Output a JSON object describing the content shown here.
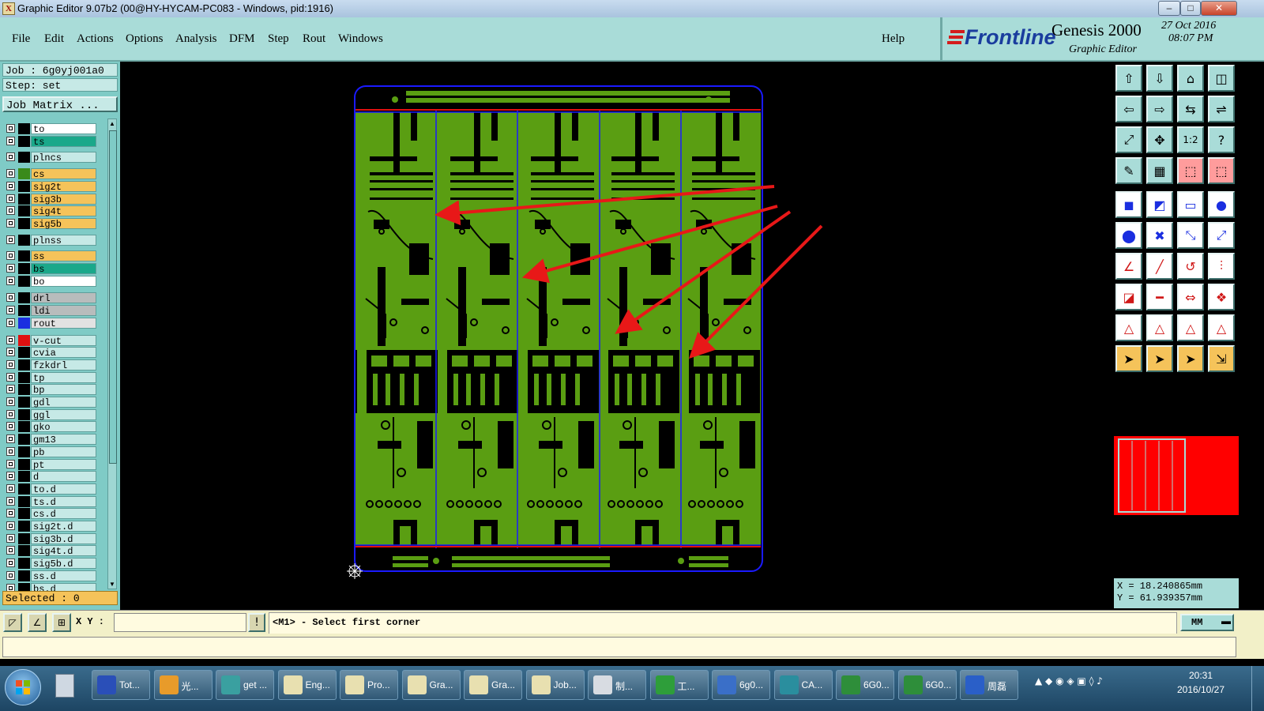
{
  "window": {
    "title": "Graphic Editor 9.07b2 (00@HY-HYCAM-PC083 - Windows, pid:1916)",
    "controls": [
      "–",
      "□",
      "✕"
    ]
  },
  "menu": {
    "items": [
      "File",
      "Edit",
      "Actions",
      "Options",
      "Analysis",
      "DFM",
      "Step",
      "Rout",
      "Windows"
    ],
    "help": "Help"
  },
  "brand": {
    "logo": "Frontline",
    "product": "Genesis 2000",
    "subtitle": "Graphic Editor",
    "date": "27 Oct 2016",
    "time": "08:07 PM"
  },
  "job": {
    "job_label": "Job : 6g0yj001a0",
    "step_label": "Step: set",
    "matrix_button": "Job Matrix ..."
  },
  "layers": [
    {
      "name": "to",
      "color": "#000000",
      "bg": "#ffffff"
    },
    {
      "name": "ts",
      "color": "#000000",
      "bg": "#1aa88a"
    },
    {
      "name": "plncs",
      "color": "#000000",
      "bg": "#c6e9e6"
    },
    {
      "name": "cs",
      "color": "#3a8a1a",
      "bg": "#f5c35a"
    },
    {
      "name": "sig2t",
      "color": "#000000",
      "bg": "#f5c35a"
    },
    {
      "name": "sig3b",
      "color": "#000000",
      "bg": "#f5c35a"
    },
    {
      "name": "sig4t",
      "color": "#000000",
      "bg": "#f5c35a"
    },
    {
      "name": "sig5b",
      "color": "#000000",
      "bg": "#f5c35a"
    },
    {
      "name": "plnss",
      "color": "#000000",
      "bg": "#c6e9e6"
    },
    {
      "name": "ss",
      "color": "#000000",
      "bg": "#f5c35a"
    },
    {
      "name": "bs",
      "color": "#000000",
      "bg": "#1aa88a"
    },
    {
      "name": "bo",
      "color": "#000000",
      "bg": "#ffffff"
    },
    {
      "name": "drl",
      "color": "#000000",
      "bg": "#b8bcbc"
    },
    {
      "name": "ldi",
      "color": "#000000",
      "bg": "#b8bcbc"
    },
    {
      "name": "rout",
      "color": "#1a2ee0",
      "bg": "#e2e2e2"
    },
    {
      "name": "v-cut",
      "color": "#e01010",
      "bg": "#c6e9e6"
    },
    {
      "name": "cvia",
      "color": "#000000",
      "bg": "#c6e9e6"
    },
    {
      "name": "fzkdrl",
      "color": "#000000",
      "bg": "#c6e9e6"
    },
    {
      "name": "tp",
      "color": "#000000",
      "bg": "#c6e9e6"
    },
    {
      "name": "bp",
      "color": "#000000",
      "bg": "#c6e9e6"
    },
    {
      "name": "gdl",
      "color": "#000000",
      "bg": "#c6e9e6"
    },
    {
      "name": "ggl",
      "color": "#000000",
      "bg": "#c6e9e6"
    },
    {
      "name": "gko",
      "color": "#000000",
      "bg": "#c6e9e6"
    },
    {
      "name": "gm13",
      "color": "#000000",
      "bg": "#c6e9e6"
    },
    {
      "name": "pb",
      "color": "#000000",
      "bg": "#c6e9e6"
    },
    {
      "name": "pt",
      "color": "#000000",
      "bg": "#c6e9e6"
    },
    {
      "name": "d",
      "color": "#000000",
      "bg": "#c6e9e6"
    },
    {
      "name": "to.d",
      "color": "#000000",
      "bg": "#c6e9e6"
    },
    {
      "name": "ts.d",
      "color": "#000000",
      "bg": "#c6e9e6"
    },
    {
      "name": "cs.d",
      "color": "#000000",
      "bg": "#c6e9e6"
    },
    {
      "name": "sig2t.d",
      "color": "#000000",
      "bg": "#c6e9e6"
    },
    {
      "name": "sig3b.d",
      "color": "#000000",
      "bg": "#c6e9e6"
    },
    {
      "name": "sig4t.d",
      "color": "#000000",
      "bg": "#c6e9e6"
    },
    {
      "name": "sig5b.d",
      "color": "#000000",
      "bg": "#c6e9e6"
    },
    {
      "name": "ss.d",
      "color": "#000000",
      "bg": "#c6e9e6"
    },
    {
      "name": "bs.d",
      "color": "#000000",
      "bg": "#c6e9e6"
    }
  ],
  "selected": "Selected : 0",
  "coords": {
    "x": "X = 18.240865mm",
    "y": "Y = 61.939357mm"
  },
  "command": {
    "xy_label": "X Y :",
    "xy_value": "",
    "prompt": "<M1> - Select first corner",
    "units": "MM"
  },
  "taskbar": {
    "items": [
      "Tot...",
      "光...",
      "get ...",
      "Eng...",
      "Pro...",
      "Gra...",
      "Gra...",
      "Job...",
      "制...",
      "工...",
      "6g0...",
      "CA...",
      "6G0...",
      "6G0...",
      "周磊"
    ],
    "clock_time": "20:31",
    "clock_date": "2016/10/27"
  },
  "colors": {
    "panel": "#a9dcd8",
    "copper": "#5a9e12",
    "arrow": "#e81818",
    "profile": "#1a1aff"
  }
}
